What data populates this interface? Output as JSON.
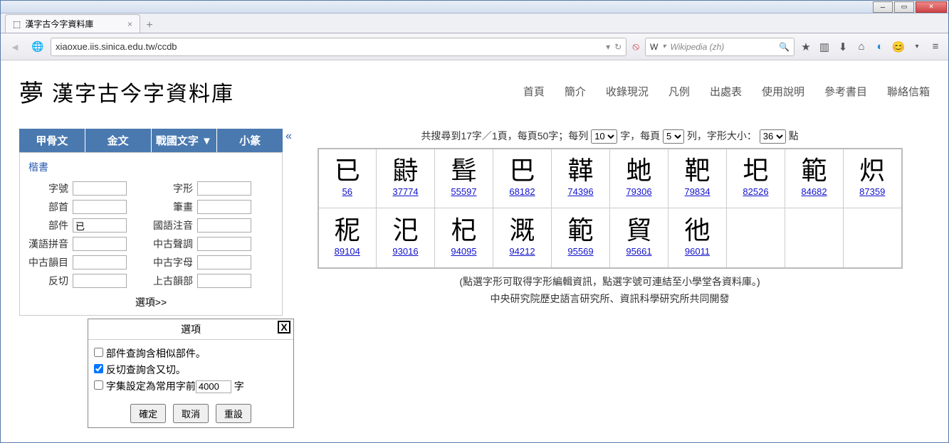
{
  "window": {
    "tab_title": "漢字古今字資料庫",
    "url": "xiaoxue.iis.sinica.edu.tw/ccdb",
    "search_placeholder": "Wikipedia (zh)"
  },
  "header": {
    "site_title": "漢字古今字資料庫",
    "nav": [
      "首頁",
      "簡介",
      "收錄現況",
      "凡例",
      "出處表",
      "使用說明",
      "參考書目",
      "聯絡信箱"
    ]
  },
  "script_tabs": [
    "甲骨文",
    "金文",
    "戰國文字 ▼",
    "小篆"
  ],
  "form": {
    "title": "楷書",
    "labels": {
      "zihao": "字號",
      "zixing": "字形",
      "bushou": "部首",
      "bihua": "筆畫",
      "bujian": "部件",
      "guoyu": "國語注音",
      "hanyu": "漢語拼音",
      "zhonggu_sheng": "中古聲調",
      "zhonggu_yun": "中古韻目",
      "zhonggu_zimu": "中古字母",
      "fanqie": "反切",
      "shanggu_yun": "上古韻部"
    },
    "values": {
      "bujian": "已"
    },
    "options_link": "選項>>"
  },
  "options": {
    "title": "選項",
    "opt1": "部件查詢含相似部件。",
    "opt2": "反切查詢含又切。",
    "opt3_pre": "字集設定為常用字前",
    "opt3_val": "4000",
    "opt3_post": "字",
    "opt1_checked": false,
    "opt2_checked": true,
    "opt3_checked": false,
    "btn_ok": "確定",
    "btn_cancel": "取消",
    "btn_reset": "重設"
  },
  "results": {
    "summary_pre": "共搜尋到17字／1頁，每頁50字；每列",
    "per_row": "10",
    "summary_mid1": "字，每頁",
    "rows": "5",
    "summary_mid2": "列，字形大小：",
    "fontsize": "36",
    "summary_post": "點",
    "glyphs": [
      {
        "char": "已",
        "id": "56"
      },
      {
        "char": "鼭",
        "id": "37774"
      },
      {
        "char": "髶",
        "id": "55597"
      },
      {
        "char": "巴",
        "id": "68182"
      },
      {
        "char": "韚",
        "id": "74396"
      },
      {
        "char": "虵",
        "id": "79306"
      },
      {
        "char": "靶",
        "id": "79834"
      },
      {
        "char": "圯",
        "id": "82526"
      },
      {
        "char": "範",
        "id": "84682"
      },
      {
        "char": "炽",
        "id": "87359"
      },
      {
        "char": "秜",
        "id": "89104"
      },
      {
        "char": "汜",
        "id": "93016"
      },
      {
        "char": "杞",
        "id": "94095"
      },
      {
        "char": "溉",
        "id": "94212"
      },
      {
        "char": "範",
        "id": "95569"
      },
      {
        "char": "貿",
        "id": "95661"
      },
      {
        "char": "彵",
        "id": "96011"
      }
    ],
    "note1": "(點選字形可取得字形編輯資訊，點選字號可連結至小學堂各資料庫。)",
    "note2": "中央研究院歷史語言研究所、資訊科學研究所共同開發"
  }
}
